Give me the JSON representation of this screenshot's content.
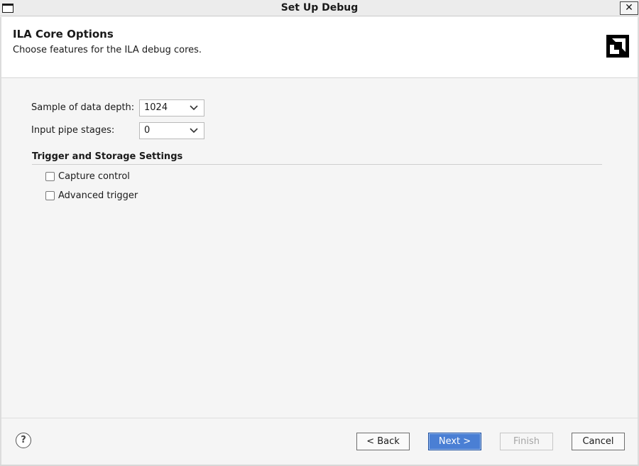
{
  "window": {
    "title": "Set Up Debug",
    "close_label": "✕"
  },
  "header": {
    "title": "ILA Core Options",
    "subtitle": "Choose features for the ILA debug cores."
  },
  "form": {
    "sample_depth_label": "Sample of data depth:",
    "sample_depth_value": "1024",
    "pipe_stages_label": "Input pipe stages:",
    "pipe_stages_value": "0"
  },
  "trigger_section": {
    "title": "Trigger and Storage Settings",
    "capture_control_label": "Capture control",
    "capture_control_checked": false,
    "advanced_trigger_label": "Advanced trigger",
    "advanced_trigger_checked": false
  },
  "footer": {
    "help_label": "?",
    "back_label": "< Back",
    "next_label": "Next >",
    "finish_label": "Finish",
    "cancel_label": "Cancel"
  },
  "icons": {
    "window": "window-icon",
    "logo": "amd-logo-icon",
    "dropdown": "chevron-down-icon",
    "help": "help-icon"
  },
  "colors": {
    "primary_button": "#4a7fd4",
    "logo": "#000000"
  }
}
